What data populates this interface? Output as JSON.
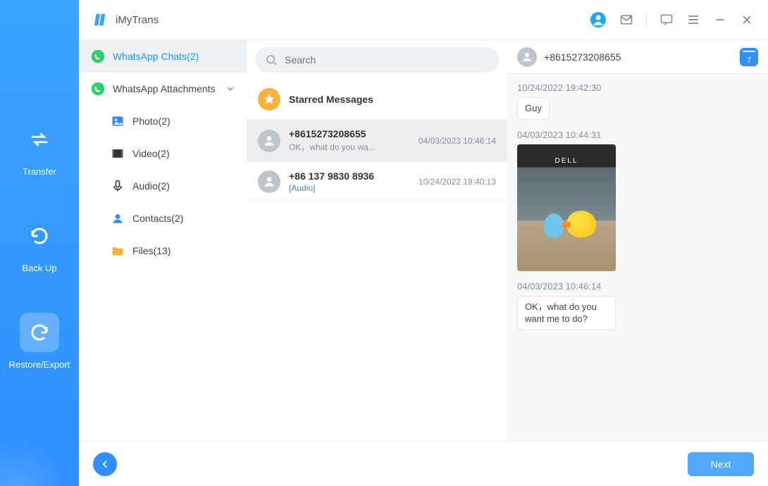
{
  "app": {
    "title": "iMyTrans"
  },
  "rail": {
    "items": [
      {
        "label": "Transfer"
      },
      {
        "label": "Back Up"
      },
      {
        "label": "Restore/Export"
      }
    ]
  },
  "titlebar_icons": {
    "user": "user-badge-icon",
    "mail": "mail-icon",
    "chat": "chat-icon",
    "menu": "menu-icon",
    "minimize": "minimize-icon",
    "close": "close-icon"
  },
  "tree": {
    "chats": {
      "label": "WhatsApp Chats(2)"
    },
    "attachments": {
      "label": "WhatsApp Attachments"
    },
    "items": [
      {
        "icon": "photo",
        "label": "Photo(2)"
      },
      {
        "icon": "video",
        "label": "Video(2)"
      },
      {
        "icon": "audio",
        "label": "Audio(2)"
      },
      {
        "icon": "contacts",
        "label": "Contacts(2)"
      },
      {
        "icon": "files",
        "label": "Files(13)"
      }
    ]
  },
  "search": {
    "placeholder": "Search"
  },
  "chatlist": {
    "starred": {
      "label": "Starred Messages"
    },
    "items": [
      {
        "title": "+8615273208655",
        "preview": "OK，what do you wa...",
        "time": "04/03/2023 10:46:14"
      },
      {
        "title": "+86 137 9830 8936",
        "preview": "[Audio]",
        "time": "10/24/2022 19:40:13"
      }
    ]
  },
  "conversation": {
    "title": "+8615273208655",
    "calendar_day": "7",
    "messages": [
      {
        "ts": "10/24/2022 19:42:30",
        "type": "text",
        "text": "Guy"
      },
      {
        "ts": "04/03/2023 10:44:31",
        "type": "image"
      },
      {
        "ts": "04/03/2023 10:46:14",
        "type": "text",
        "text": "OK，what do you want me to do?"
      }
    ]
  },
  "footer": {
    "next": "Next"
  }
}
